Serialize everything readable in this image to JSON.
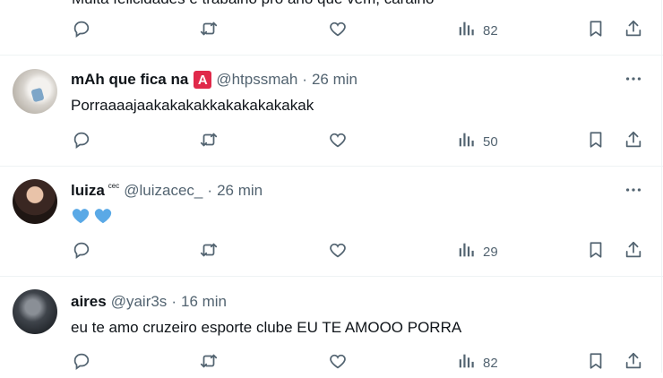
{
  "top_partial": {
    "clipped_text": "Muita felicidades e trabalho pro ano que vem, caralho",
    "views": "82"
  },
  "tweets": [
    {
      "display_name": "mAh que fica na",
      "badge": "A",
      "handle": "@htpssmah",
      "separator": "·",
      "time": "26 min",
      "text": "Porraaaajaakakakakkakakakakakak",
      "views": "50"
    },
    {
      "display_name": "luiza",
      "tiny_label": "cec",
      "handle": "@luizacec_",
      "separator": "·",
      "time": "26 min",
      "emoji": "blue-heart-icon x2",
      "views": "29"
    },
    {
      "display_name": "aires",
      "handle": "@yair3s",
      "separator": "·",
      "time": "16 min",
      "text": "eu te amo cruzeiro esporte clube EU TE AMOOO PORRA",
      "views": "82"
    }
  ],
  "icons": {
    "reply": "reply-icon",
    "retweet": "retweet-icon",
    "like": "heart-icon",
    "views": "views-icon",
    "bookmark": "bookmark-icon",
    "share": "share-icon",
    "more": "more-icon"
  },
  "colors": {
    "text": "#0f1419",
    "muted": "#536471",
    "divider": "#eff3f4",
    "badge": "#e0294a",
    "heart_emoji": "#5aa9e6"
  }
}
